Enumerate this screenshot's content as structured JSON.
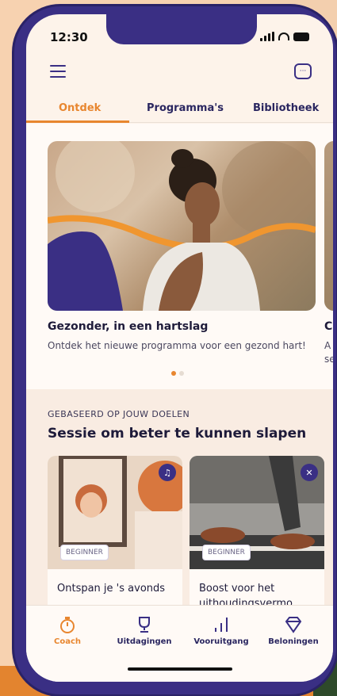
{
  "status": {
    "time": "12:30"
  },
  "tabs": [
    {
      "label": "Ontdek"
    },
    {
      "label": "Programma's"
    },
    {
      "label": "Bibliotheek"
    }
  ],
  "featured": {
    "title": "Gezonder, in een hartslag",
    "description": "Ontdek het nieuwe programma voor een gezond hart!",
    "peek_title": "C",
    "peek_description": "A se"
  },
  "recommended": {
    "eyebrow": "GEBASEERD OP JOUW DOELEN",
    "title": "Sessie om beter te kunnen slapen",
    "cards": [
      {
        "title": "Ontspan je 's avonds",
        "badge": "BEGINNER",
        "icon": "headphones-icon"
      },
      {
        "title": "Boost voor het uithoudingsvermo...",
        "badge": "BEGINNER",
        "icon": "running-icon"
      }
    ]
  },
  "bottom_nav": [
    {
      "label": "Coach",
      "icon": "stopwatch-icon",
      "active": true
    },
    {
      "label": "Uitdagingen",
      "icon": "trophy-icon"
    },
    {
      "label": "Vooruitgang",
      "icon": "bar-chart-icon"
    },
    {
      "label": "Beloningen",
      "icon": "diamond-icon"
    }
  ],
  "colors": {
    "accent": "#e8862f",
    "brand": "#3a2f84"
  }
}
